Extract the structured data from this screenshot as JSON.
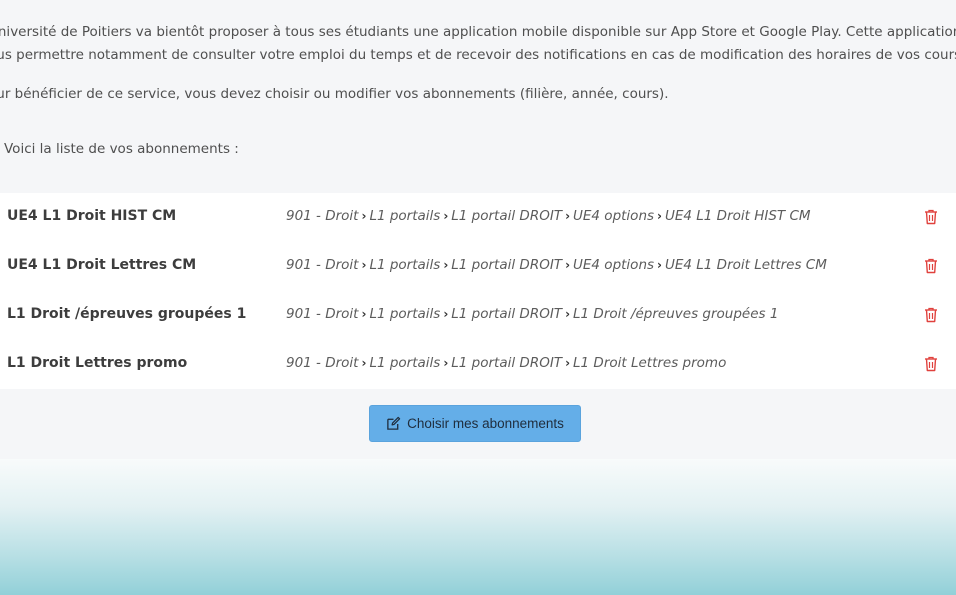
{
  "intro": {
    "line1": "Université de Poitiers va bientôt proposer à tous ses étudiants une application mobile disponible sur App Store et Google Play. Cette application va",
    "line2": "ous permettre notamment de consulter votre emploi du temps et de recevoir des notifications en cas de modification des horaires de vos cours.",
    "line3": "our bénéficier de ce service, vous devez choisir ou modifier vos abonnements (filière, année, cours).",
    "list_intro": "Voici la liste de vos abonnements :"
  },
  "subscriptions": [
    {
      "name": "UE4 L1 Droit HIST CM",
      "path": [
        "901 - Droit",
        "L1 portails",
        "L1 portail DROIT",
        "UE4 options",
        "UE4 L1 Droit HIST CM"
      ]
    },
    {
      "name": "UE4 L1 Droit Lettres CM",
      "path": [
        "901 - Droit",
        "L1 portails",
        "L1 portail DROIT",
        "UE4 options",
        "UE4 L1 Droit Lettres CM"
      ]
    },
    {
      "name": "L1 Droit /épreuves groupées 1",
      "path": [
        "901 - Droit",
        "L1 portails",
        "L1 portail DROIT",
        "L1 Droit /épreuves groupées 1"
      ]
    },
    {
      "name": "L1 Droit Lettres promo",
      "path": [
        "901 - Droit",
        "L1 portails",
        "L1 portail DROIT",
        "L1 Droit Lettres promo"
      ]
    }
  ],
  "actions": {
    "choose_label": "Choisir mes abonnements"
  },
  "icons": {
    "delete": "trash-icon",
    "edit": "edit-icon",
    "separator": "chevron-right-icon"
  },
  "colors": {
    "button_bg": "#64aee8",
    "delete_icon": "#e0413d",
    "panel_bg": "#f5f6f8"
  }
}
